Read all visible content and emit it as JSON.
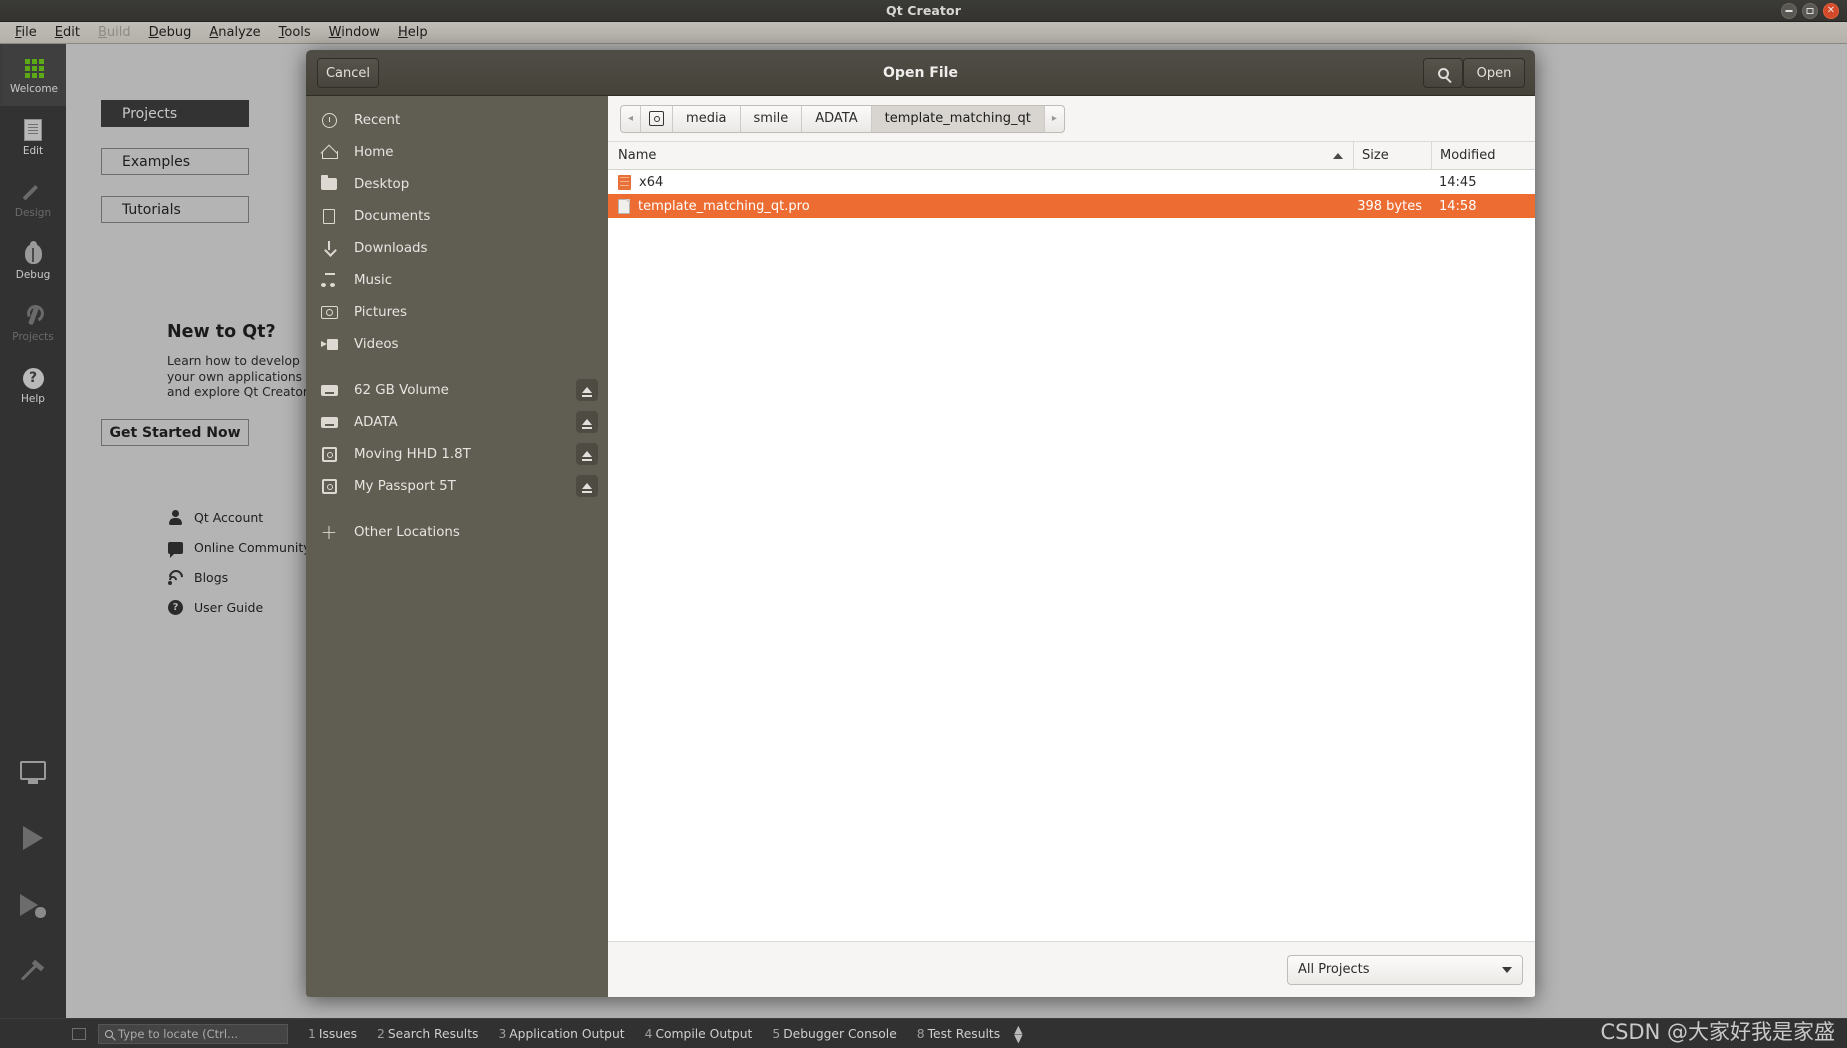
{
  "window": {
    "title": "Qt Creator",
    "controls": [
      "minimize",
      "maximize",
      "close"
    ]
  },
  "menubar": {
    "items": [
      {
        "label": "File",
        "mnemonic": "F",
        "disabled": false
      },
      {
        "label": "Edit",
        "mnemonic": "E",
        "disabled": false
      },
      {
        "label": "Build",
        "mnemonic": "B",
        "disabled": true
      },
      {
        "label": "Debug",
        "mnemonic": "D",
        "disabled": false
      },
      {
        "label": "Analyze",
        "mnemonic": "A",
        "disabled": false
      },
      {
        "label": "Tools",
        "mnemonic": "T",
        "disabled": false
      },
      {
        "label": "Window",
        "mnemonic": "W",
        "disabled": false
      },
      {
        "label": "Help",
        "mnemonic": "H",
        "disabled": false
      }
    ]
  },
  "modebar": {
    "modes": [
      {
        "label": "Welcome",
        "icon": "grid-icon",
        "active": true,
        "disabled": false
      },
      {
        "label": "Edit",
        "icon": "document-icon",
        "active": false,
        "disabled": false
      },
      {
        "label": "Design",
        "icon": "pencil-icon",
        "active": false,
        "disabled": true
      },
      {
        "label": "Debug",
        "icon": "bug-icon",
        "active": false,
        "disabled": false
      },
      {
        "label": "Projects",
        "icon": "wrench-icon",
        "active": false,
        "disabled": true
      },
      {
        "label": "Help",
        "icon": "question-circle-icon",
        "active": false,
        "disabled": false
      }
    ],
    "bottom_tools": [
      {
        "name": "kit-selector",
        "icon": "monitor-icon"
      },
      {
        "name": "run",
        "icon": "play-icon"
      },
      {
        "name": "debug",
        "icon": "play-bug-icon"
      },
      {
        "name": "build",
        "icon": "hammer-icon"
      }
    ]
  },
  "welcome": {
    "tabs": [
      {
        "label": "Projects",
        "active": true
      },
      {
        "label": "Examples",
        "active": false
      },
      {
        "label": "Tutorials",
        "active": false
      }
    ],
    "new_to_qt_title": "New to Qt?",
    "new_to_qt_text": "Learn how to develop your own applications and explore Qt Creator.",
    "get_started_label": "Get Started Now",
    "links": [
      {
        "label": "Qt Account",
        "icon": "person-icon"
      },
      {
        "label": "Online Community",
        "icon": "speech-bubble-icon"
      },
      {
        "label": "Blogs",
        "icon": "rss-icon"
      },
      {
        "label": "User Guide",
        "icon": "question-circle-icon"
      }
    ]
  },
  "dialog": {
    "title": "Open File",
    "cancel_label": "Cancel",
    "open_label": "Open",
    "search_icon": "search-icon",
    "breadcrumb": {
      "left_arrow": "◂",
      "right_arrow": "▸",
      "device_icon": "drive-icon",
      "crumbs": [
        {
          "label": "media",
          "active": false
        },
        {
          "label": "smile",
          "active": false
        },
        {
          "label": "ADATA",
          "active": false
        },
        {
          "label": "template_matching_qt",
          "active": true
        }
      ]
    },
    "places": [
      {
        "label": "Recent",
        "icon": "clock-icon",
        "eject": false
      },
      {
        "label": "Home",
        "icon": "home-icon",
        "eject": false
      },
      {
        "label": "Desktop",
        "icon": "folder-icon",
        "eject": false
      },
      {
        "label": "Documents",
        "icon": "document-icon",
        "eject": false
      },
      {
        "label": "Downloads",
        "icon": "download-icon",
        "eject": false
      },
      {
        "label": "Music",
        "icon": "music-icon",
        "eject": false
      },
      {
        "label": "Pictures",
        "icon": "camera-icon",
        "eject": false
      },
      {
        "label": "Videos",
        "icon": "video-icon",
        "eject": false
      },
      {
        "label": "62 GB Volume",
        "icon": "drive-icon",
        "eject": true
      },
      {
        "label": "ADATA",
        "icon": "drive-icon",
        "eject": true
      },
      {
        "label": "Moving HHD 1.8T",
        "icon": "disk-icon",
        "eject": true
      },
      {
        "label": "My Passport 5T",
        "icon": "disk-icon",
        "eject": true
      },
      {
        "label": "Other Locations",
        "icon": "plus-icon",
        "eject": false
      }
    ],
    "columns": [
      {
        "label": "Name",
        "sorted": "asc"
      },
      {
        "label": "Size",
        "sorted": null
      },
      {
        "label": "Modified",
        "sorted": null
      }
    ],
    "files": [
      {
        "name": "x64",
        "size": "",
        "modified": "14:45",
        "type": "folder",
        "selected": false
      },
      {
        "name": "template_matching_qt.pro",
        "size": "398 bytes",
        "modified": "14:58",
        "type": "file",
        "selected": true
      }
    ],
    "filter": {
      "value": "All Projects"
    },
    "selection_color": "#ec6c32"
  },
  "statusbar": {
    "locator_placeholder": "Type to locate (Ctrl...",
    "panes": [
      {
        "num": "1",
        "label": "Issues"
      },
      {
        "num": "2",
        "label": "Search Results"
      },
      {
        "num": "3",
        "label": "Application Output"
      },
      {
        "num": "4",
        "label": "Compile Output"
      },
      {
        "num": "5",
        "label": "Debugger Console"
      },
      {
        "num": "8",
        "label": "Test Results"
      }
    ],
    "toggle_icon": "up-down-arrows"
  },
  "watermark": {
    "text": "CSDN @大家好我是家盛"
  }
}
